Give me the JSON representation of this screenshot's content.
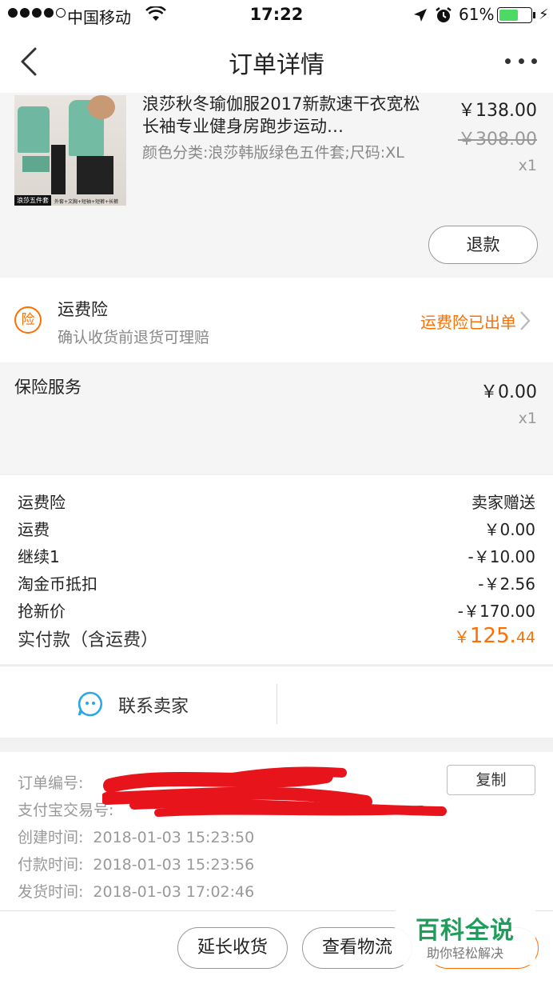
{
  "status_bar": {
    "carrier": "中国移动",
    "time": "17:22",
    "battery_pct": "61%",
    "battery_level": 0.61
  },
  "nav": {
    "title": "订单详情"
  },
  "product": {
    "name": "浪莎秋冬瑜伽服2017新款速干衣宽松长袖专业健身房跑步运动…",
    "sku": "颜色分类:浪莎韩版绿色五件套;尺码:XL",
    "price": "￥138.00",
    "original_price": "￥308.00",
    "quantity": "x1",
    "image_tag": "浪莎五件套",
    "image_caption": "外套+文胸+短袖+短裤+长裤",
    "refund_label": "退款"
  },
  "insurance": {
    "icon_char": "险",
    "title": "运费险",
    "subtitle": "确认收货前退货可理赔",
    "status": "运费险已出单"
  },
  "service": {
    "label": "保险服务",
    "price": "￥0.00",
    "quantity": "x1"
  },
  "summary": {
    "rows": [
      {
        "label": "运费险",
        "value": "卖家赠送"
      },
      {
        "label": "运费",
        "value": "￥0.00"
      },
      {
        "label": "继续1",
        "value": "-￥10.00"
      },
      {
        "label": "淘金币抵扣",
        "value": "-￥2.56"
      },
      {
        "label": "抢新价",
        "value": "-￥170.00"
      }
    ],
    "total_label": "实付款（含运费）",
    "total_currency": "￥",
    "total_integer": "125.",
    "total_decimal": "44"
  },
  "contact": {
    "label": "联系卖家"
  },
  "order_info": {
    "order_no_label": "订单编号:",
    "alipay_label": "支付宝交易号:",
    "created_label": "创建时间:",
    "created_value": "2018-01-03 15:23:50",
    "paid_label": "付款时间:",
    "paid_value": "2018-01-03 15:23:56",
    "shipped_label": "发货时间:",
    "shipped_value": "2018-01-03 17:02:46",
    "copy_label": "复制"
  },
  "bottom_bar": {
    "extend_label": "延长收货",
    "logistics_label": "查看物流",
    "confirm_label": ""
  },
  "watermark": {
    "main": "百科全说",
    "sub": "助你轻松解决"
  },
  "colors": {
    "accent": "#ff6f00",
    "battery": "#4cd964",
    "watermark": "#1e9e5a",
    "redaction": "#e8141b"
  }
}
